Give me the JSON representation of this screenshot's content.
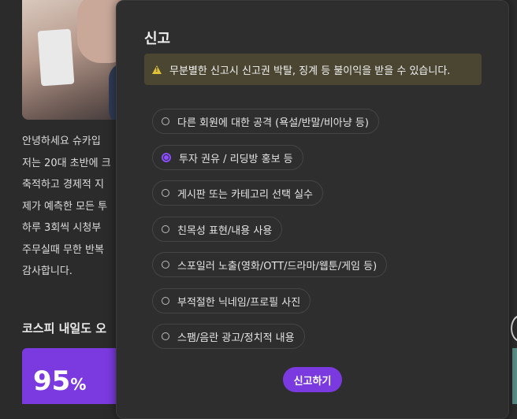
{
  "background": {
    "intro_lines": [
      "안녕하세요 슈카입",
      "저는 20대 초반에 크",
      "축적하고 경제적 지",
      "제가 예측한 모든 투",
      "하루 3회씩 시청부",
      "주무실때 무한 반복",
      "감사합니다."
    ],
    "section_heading": "코스피 내일도 오",
    "card_percent": "95",
    "card_percent_unit": "%"
  },
  "modal": {
    "title": "신고",
    "warning_icon": "warning-triangle-icon",
    "warning_text": "무분별한 신고시 신고권 박탈, 징계 등 불이익을 받을 수 있습니다.",
    "options": [
      {
        "label": "다른 회원에 대한 공격 (욕설/반말/비아냥 등)",
        "selected": false
      },
      {
        "label": "투자 권유 / 리딩방 홍보 등",
        "selected": true
      },
      {
        "label": "게시판 또는 카테고리 선택 실수",
        "selected": false
      },
      {
        "label": "친목성 표현/내용 사용",
        "selected": false
      },
      {
        "label": "스포일러 노출(영화/OTT/드라마/웹툰/게임 등)",
        "selected": false
      },
      {
        "label": "부적절한 닉네임/프로필 사진",
        "selected": false
      },
      {
        "label": "스팸/음란 광고/정치적 내용",
        "selected": false
      }
    ],
    "submit_label": "신고하기"
  },
  "colors": {
    "accent": "#7b3ae0",
    "radio_selected": "#8a4dff",
    "warning_bg": "#4a4632",
    "warning_icon": "#e0c23a",
    "modal_bg": "#2e2e2e",
    "page_bg": "#2b2b2b"
  }
}
